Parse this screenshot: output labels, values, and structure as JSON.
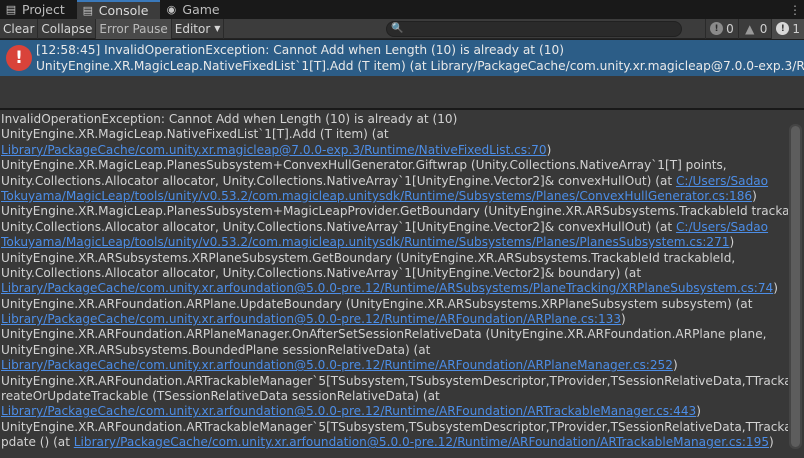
{
  "tabs": [
    {
      "label": "Project",
      "icon": "folder-icon"
    },
    {
      "label": "Console",
      "icon": "console-icon",
      "active": true
    },
    {
      "label": "Game",
      "icon": "game-icon"
    }
  ],
  "toolbar": {
    "clear": "Clear",
    "collapse": "Collapse",
    "error_pause": "Error Pause",
    "editor": "Editor",
    "search_placeholder": "",
    "info_count": "0",
    "warning_count": "0",
    "error_count": "1"
  },
  "entry": {
    "line1": "[12:58:45] InvalidOperationException: Cannot Add when Length (10) is already at (10)",
    "line2": "UnityEngine.XR.MagicLeap.NativeFixedList`1[T].Add (T item) (at Library/PackageCache/com.unity.xr.magicleap@7.0.0-exp.3/Runtime/N"
  },
  "trace": [
    {
      "text": "InvalidOperationException: Cannot Add when Length (10) is already at (10)"
    },
    {
      "text": "UnityEngine.XR.MagicLeap.NativeFixedList`1[T].Add (T item) (at "
    },
    {
      "link": "Library/PackageCache/com.unity.xr.magicleap@7.0.0-exp.3/Runtime/NativeFixedList.cs:70",
      "after": ")"
    },
    {
      "text": "UnityEngine.XR.MagicLeap.PlanesSubsystem+ConvexHullGenerator.Giftwrap (Unity.Collections.NativeArray`1[T] points,"
    },
    {
      "text": "Unity.Collections.Allocator allocator, Unity.Collections.NativeArray`1[UnityEngine.Vector2]& convexHullOut) (at ",
      "link": "C:/Users/Sadao"
    },
    {
      "link": "Tokuyama/MagicLeap/tools/unity/v0.53.2/com.magicleap.unitysdk/Runtime/Subsystems/Planes/ConvexHullGenerator.cs:186",
      "after": ")"
    },
    {
      "text": "UnityEngine.XR.MagicLeap.PlanesSubsystem+MagicLeapProvider.GetBoundary (UnityEngine.XR.ARSubsystems.TrackableId trackableId,"
    },
    {
      "text": "Unity.Collections.Allocator allocator, Unity.Collections.NativeArray`1[UnityEngine.Vector2]& convexHullOut) (at ",
      "link": "C:/Users/Sadao"
    },
    {
      "link": "Tokuyama/MagicLeap/tools/unity/v0.53.2/com.magicleap.unitysdk/Runtime/Subsystems/Planes/PlanesSubsystem.cs:271",
      "after": ")"
    },
    {
      "text": "UnityEngine.XR.ARSubsystems.XRPlaneSubsystem.GetBoundary (UnityEngine.XR.ARSubsystems.TrackableId trackableId,"
    },
    {
      "text": "Unity.Collections.Allocator allocator, Unity.Collections.NativeArray`1[UnityEngine.Vector2]& boundary) (at"
    },
    {
      "link": "Library/PackageCache/com.unity.xr.arfoundation@5.0.0-pre.12/Runtime/ARSubsystems/PlaneTracking/XRPlaneSubsystem.cs:74",
      "after": ")"
    },
    {
      "text": "UnityEngine.XR.ARFoundation.ARPlane.UpdateBoundary (UnityEngine.XR.ARSubsystems.XRPlaneSubsystem subsystem) (at"
    },
    {
      "link": "Library/PackageCache/com.unity.xr.arfoundation@5.0.0-pre.12/Runtime/ARFoundation/ARPlane.cs:133",
      "after": ")"
    },
    {
      "text": "UnityEngine.XR.ARFoundation.ARPlaneManager.OnAfterSetSessionRelativeData (UnityEngine.XR.ARFoundation.ARPlane plane,"
    },
    {
      "text": "UnityEngine.XR.ARSubsystems.BoundedPlane sessionRelativeData) (at"
    },
    {
      "link": "Library/PackageCache/com.unity.xr.arfoundation@5.0.0-pre.12/Runtime/ARFoundation/ARPlaneManager.cs:252",
      "after": ")"
    },
    {
      "text": "UnityEngine.XR.ARFoundation.ARTrackableManager`5[TSubsystem,TSubsystemDescriptor,TProvider,TSessionRelativeData,TTrackable].C"
    },
    {
      "text": "reateOrUpdateTrackable (TSessionRelativeData sessionRelativeData) (at"
    },
    {
      "link": "Library/PackageCache/com.unity.xr.arfoundation@5.0.0-pre.12/Runtime/ARFoundation/ARTrackableManager.cs:443",
      "after": ")"
    },
    {
      "text": "UnityEngine.XR.ARFoundation.ARTrackableManager`5[TSubsystem,TSubsystemDescriptor,TProvider,TSessionRelativeData,TTrackable].U"
    },
    {
      "text": "pdate () (at ",
      "link": "Library/PackageCache/com.unity.xr.arfoundation@5.0.0-pre.12/Runtime/ARFoundation/ARTrackableManager.cs:195",
      "after": ")"
    }
  ]
}
